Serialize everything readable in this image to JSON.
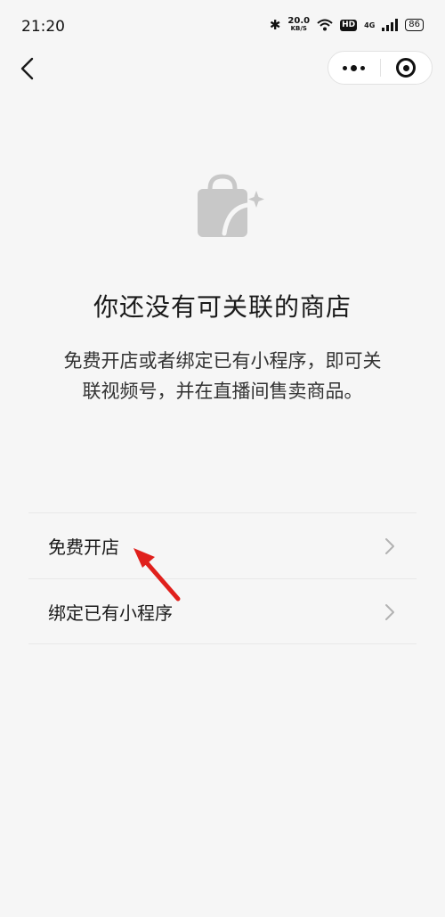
{
  "status_bar": {
    "time": "21:20",
    "bluetooth_icon": "bluetooth-icon",
    "net_speed_value": "20.0",
    "net_speed_unit": "KB/S",
    "hd_badge": "HD",
    "network_type": "4G",
    "battery": "86"
  },
  "nav": {
    "back_icon": "chevron-left-icon",
    "more_icon": "more-dots-icon",
    "close_icon": "target-circle-icon"
  },
  "empty_state": {
    "icon": "shopping-bag-sparkle-icon",
    "title": "你还没有可关联的商店",
    "description": "免费开店或者绑定已有小程序，即可关联视频号，并在直播间售卖商品。"
  },
  "menu": {
    "items": [
      {
        "label": "免费开店"
      },
      {
        "label": "绑定已有小程序"
      }
    ]
  },
  "colors": {
    "background": "#f6f6f6",
    "icon_gray": "#c8c8c8",
    "annotation_red": "#e0201c"
  }
}
